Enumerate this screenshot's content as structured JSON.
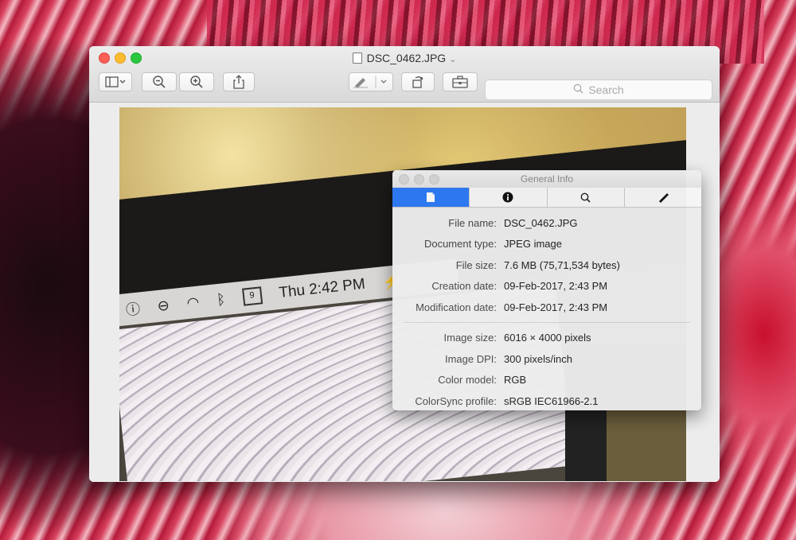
{
  "window": {
    "title": "DSC_0462.JPG",
    "title_chevron": "⌄",
    "search_placeholder": "Search"
  },
  "toolbar": {
    "sidebar_icon": "sidebar-icon",
    "zoom_out_icon": "zoom-out-icon",
    "zoom_in_icon": "zoom-in-icon",
    "share_icon": "share-icon",
    "markup_icon": "markup-pen-icon",
    "rotate_icon": "rotate-icon",
    "toolbox_icon": "toolbox-icon"
  },
  "photo": {
    "menubar_clock": "Thu 2:42 PM",
    "menubar_cal_day": "9"
  },
  "inspector": {
    "title": "General Info",
    "tabs": [
      {
        "icon": "document-icon",
        "active": true
      },
      {
        "icon": "info-icon",
        "active": false
      },
      {
        "icon": "search-icon",
        "active": false
      },
      {
        "icon": "pen-icon",
        "active": false
      }
    ],
    "general": [
      {
        "label": "File name:",
        "value": "DSC_0462.JPG"
      },
      {
        "label": "Document type:",
        "value": "JPEG image"
      },
      {
        "label": "File size:",
        "value": "7.6 MB (75,71,534 bytes)"
      },
      {
        "label": "Creation date:",
        "value": "09-Feb-2017, 2:43 PM"
      },
      {
        "label": "Modification date:",
        "value": "09-Feb-2017, 2:43 PM"
      }
    ],
    "image": [
      {
        "label": "Image size:",
        "value": "6016 × 4000 pixels"
      },
      {
        "label": "Image DPI:",
        "value": "300 pixels/inch"
      },
      {
        "label": "Color model:",
        "value": "RGB"
      },
      {
        "label": "ColorSync profile:",
        "value": "sRGB IEC61966-2.1"
      }
    ]
  },
  "colors": {
    "accent": "#2f7cf6",
    "close": "#fd5e56",
    "minimize": "#fdbb2f",
    "zoom": "#29c83f"
  }
}
